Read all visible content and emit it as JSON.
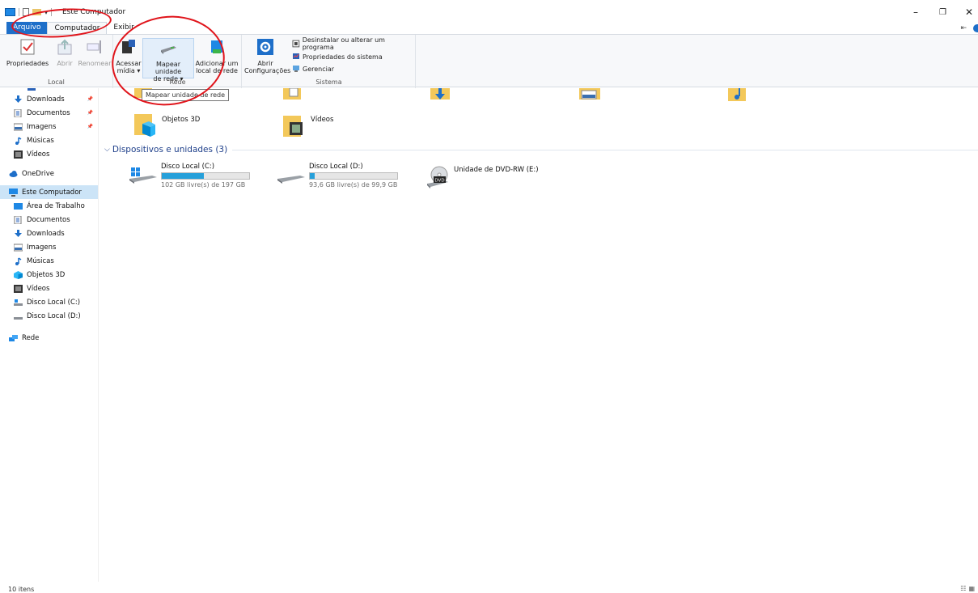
{
  "window": {
    "title": "Este Computador",
    "minimize": "–",
    "restore": "❐",
    "close": "✕"
  },
  "quick_access": {
    "arrow": "▾"
  },
  "tabs": [
    {
      "label": "Arquivo"
    },
    {
      "label": "Computador"
    },
    {
      "label": "Exibir"
    }
  ],
  "ribbon": {
    "right_icon": "⇤",
    "groups": {
      "local": {
        "label": "Local",
        "buttons": [
          "Propriedades",
          "Abrir",
          "Renomear"
        ]
      },
      "rede": {
        "label": "Rede",
        "acessar_line1": "Acessar",
        "acessar_line2": "mídia ▾",
        "mapear_line1": "Mapear unidade",
        "mapear_line2": "de rede ▾",
        "adicionar_line1": "Adicionar um",
        "adicionar_line2": "local de rede"
      },
      "sistema": {
        "label": "Sistema",
        "abrir_line1": "Abrir",
        "abrir_line2": "Configurações",
        "small": [
          "Desinstalar ou alterar um programa",
          "Propriedades do sistema",
          "Gerenciar"
        ]
      }
    }
  },
  "tooltip": "Mapear unidade de rede",
  "nav": {
    "items": [
      {
        "label": "Downloads",
        "icon": "download-icon",
        "pinned": true
      },
      {
        "label": "Documentos",
        "icon": "documents-icon",
        "pinned": true
      },
      {
        "label": "Imagens",
        "icon": "pictures-icon",
        "pinned": true
      },
      {
        "label": "Músicas",
        "icon": "music-icon",
        "pinned": false
      },
      {
        "label": "Vídeos",
        "icon": "videos-icon",
        "pinned": false
      },
      {
        "label": "OneDrive",
        "icon": "onedrive-icon",
        "pinned": false
      },
      {
        "label": "Este Computador",
        "icon": "this-pc-icon",
        "pinned": false
      },
      {
        "label": "Área de Trabalho",
        "icon": "desktop-icon",
        "pinned": false
      },
      {
        "label": "Documentos",
        "icon": "documents-icon",
        "pinned": false
      },
      {
        "label": "Downloads",
        "icon": "download-icon",
        "pinned": false
      },
      {
        "label": "Imagens",
        "icon": "pictures-icon",
        "pinned": false
      },
      {
        "label": "Músicas",
        "icon": "music-icon",
        "pinned": false
      },
      {
        "label": "Objetos 3D",
        "icon": "3d-objects-icon",
        "pinned": false
      },
      {
        "label": "Vídeos",
        "icon": "videos-icon",
        "pinned": false
      },
      {
        "label": "Disco Local (C:)",
        "icon": "drive-c-icon",
        "pinned": false
      },
      {
        "label": "Disco Local (D:)",
        "icon": "drive-d-icon",
        "pinned": false
      },
      {
        "label": "Rede",
        "icon": "network-icon",
        "pinned": false
      }
    ],
    "pin_glyph": "📌"
  },
  "folders": [
    {
      "label": "Objetos 3D"
    },
    {
      "label": "Vídeos"
    }
  ],
  "devices": {
    "header": "Dispositivos e unidades (3)",
    "chevron": "⌵",
    "drives": [
      {
        "name": "Disco Local (C:)",
        "free": "102 GB livre(s) de 197 GB",
        "used_fraction": 0.48
      },
      {
        "name": "Disco Local (D:)",
        "free": "93,6 GB livre(s) de 99,9 GB",
        "used_fraction": 0.06
      },
      {
        "name": "Unidade de DVD-RW (E:)",
        "free": "",
        "used_fraction": null
      }
    ],
    "dvd_badge": "DVD"
  },
  "status": {
    "count": "10 itens",
    "view_details": "☷",
    "view_tiles": "▦"
  },
  "colors": {
    "accent": "#1e6fc9",
    "selected": "#cce4f7",
    "annotation": "#e0141b",
    "drive_bar": "#26a0da"
  }
}
